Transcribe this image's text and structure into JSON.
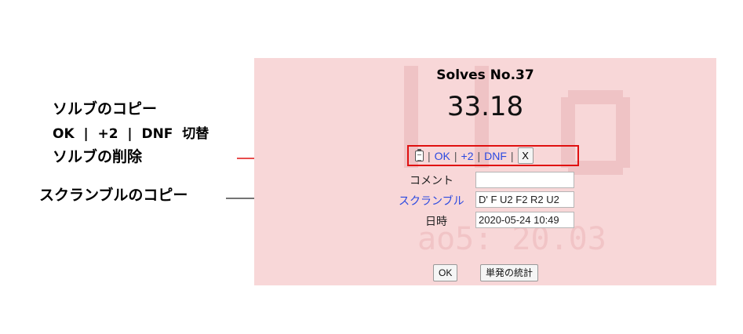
{
  "annotations": {
    "copy_solve": "ソルブのコピー",
    "ok_plus2_dnf_toggle": "OK  |  +2  |  DNF  切替",
    "delete_solve": "ソルブの削除",
    "copy_scramble": "スクランブルのコピー"
  },
  "panel": {
    "title": "Solves No.37",
    "time": "33.18",
    "background_color": "#f8d7d8",
    "watermark": "ao5: 20.03",
    "actions": {
      "ok": "OK",
      "plus2": "+2",
      "dnf": "DNF",
      "delete": "X",
      "separator": "|"
    },
    "comment_label": "コメント",
    "comment_value": "",
    "scramble_label": "スクランブル",
    "scramble_value": "D' F U2 F2 R2 U2",
    "datetime_label": "日時",
    "datetime_value": "2020-05-24 10:49",
    "ok_button": "OK",
    "stats_button": "単発の統計"
  },
  "colors": {
    "highlight_border": "#e01010",
    "link": "#2b49e0"
  }
}
